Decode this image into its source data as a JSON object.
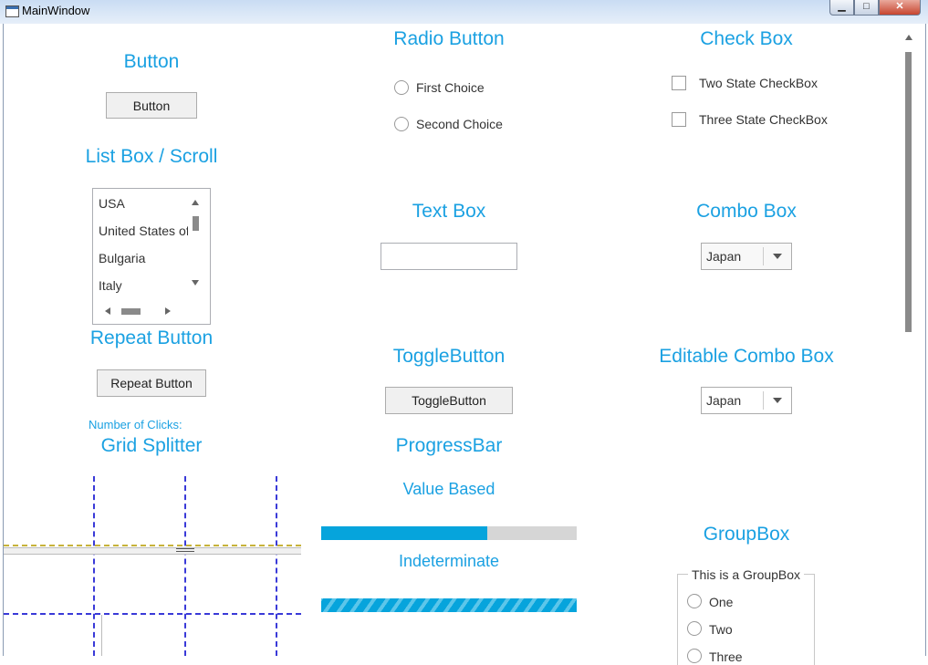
{
  "window": {
    "title": "MainWindow",
    "min_label": "▁",
    "max_label": "□",
    "close_label": "✕"
  },
  "sections": {
    "button": {
      "heading": "Button",
      "label": "Button"
    },
    "radio": {
      "heading": "Radio Button",
      "options": [
        "First Choice",
        "Second Choice"
      ]
    },
    "checkbox": {
      "heading": "Check Box",
      "options": [
        "Two State CheckBox",
        "Three State CheckBox"
      ]
    },
    "listbox": {
      "heading": "List Box / Scroll",
      "items": [
        "USA",
        "United States of",
        "Bulgaria",
        "Italy"
      ]
    },
    "textbox": {
      "heading": "Text Box",
      "value": ""
    },
    "combo": {
      "heading": "Combo Box",
      "selected": "Japan"
    },
    "repeat": {
      "heading": "Repeat Button",
      "label": "Repeat Button",
      "clicks_label": "Number of Clicks:"
    },
    "toggle": {
      "heading": "ToggleButton",
      "label": "ToggleButton"
    },
    "editable_combo": {
      "heading": "Editable Combo Box",
      "selected": "Japan"
    },
    "grid_splitter": {
      "heading": "Grid Splitter"
    },
    "progress": {
      "heading": "ProgressBar",
      "value_label": "Value Based",
      "value_fraction": 0.65,
      "indeterminate_label": "Indeterminate"
    },
    "groupbox": {
      "heading": "GroupBox",
      "title": "This is a GroupBox",
      "options": [
        "One",
        "Two",
        "Three"
      ]
    }
  },
  "colors": {
    "accent": "#1ba1e2",
    "progress_fill": "#06a4dc",
    "progress_track": "#d6d6d6"
  },
  "icons": {
    "scroll_up": "chevron-up-icon",
    "scroll_down": "chevron-down-icon",
    "dropdown": "caret-down-icon"
  }
}
